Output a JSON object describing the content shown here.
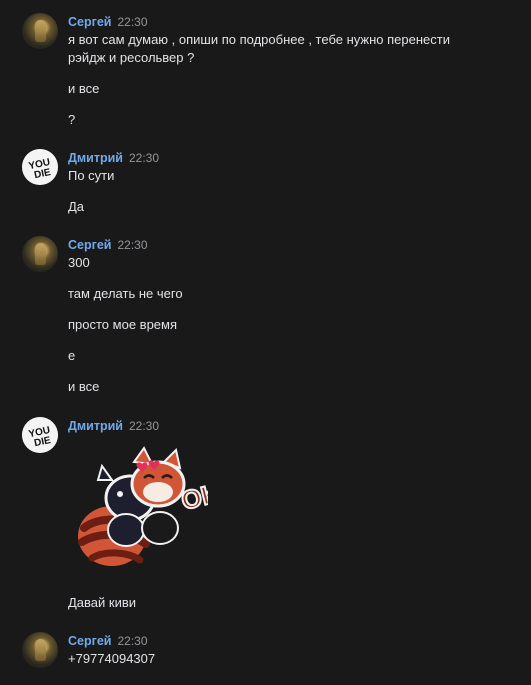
{
  "messages": [
    {
      "author": "Сергей",
      "time": "22:30",
      "lines": [
        "я вот сам думаю , опиши по подробнее , тебе нужно перенести рэйдж и ресольвер ?",
        "и все",
        "?"
      ]
    },
    {
      "author": "Дмитрий",
      "time": "22:30",
      "lines": [
        "По сути",
        "Да"
      ]
    },
    {
      "author": "Сергей",
      "time": "22:30",
      "lines": [
        "300",
        "там делать не чего",
        "просто мое время",
        "е",
        "и все"
      ]
    },
    {
      "author": "Дмитрий",
      "time": "22:30",
      "sticker": {
        "text": "OK",
        "icon": "red-panda-sticker-icon"
      },
      "lines": [
        "Давай киви"
      ]
    },
    {
      "author": "Сергей",
      "time": "22:30",
      "lines": [
        "+79774094307"
      ]
    }
  ],
  "avatars": {
    "dmitry_avatar_text": "YOU DIE"
  },
  "colors": {
    "background": "#19191a",
    "author": "#71aaeb",
    "text": "#e1e3e6",
    "time": "#939699"
  }
}
